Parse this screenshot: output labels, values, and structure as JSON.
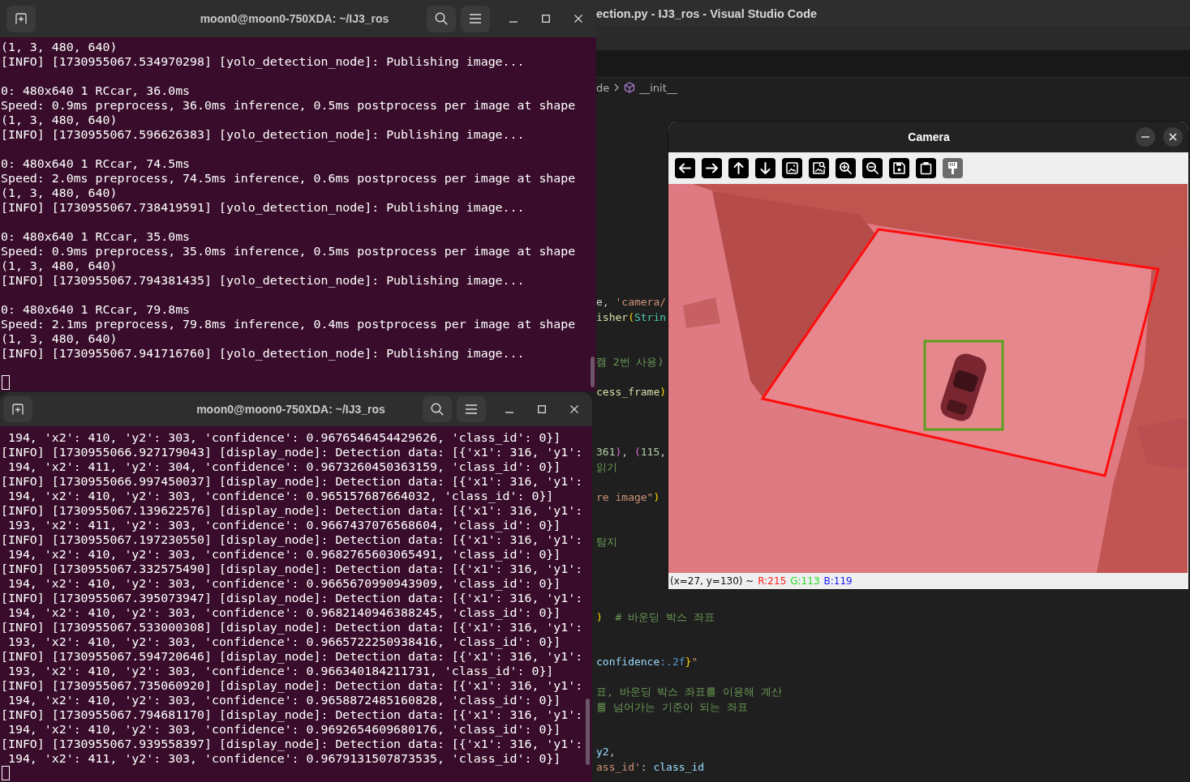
{
  "editor": {
    "title": "ection.py - IJ3_ros - Visual Studio Code",
    "breadcrumb": [
      {
        "text": "de",
        "kind": "plain"
      },
      {
        "text": "__init__",
        "kind": "method"
      }
    ],
    "lines": [
      {
        "tokens": [
          {
            "text": "e, ",
            "kind": "plain"
          },
          {
            "text": "'camera/",
            "kind": "string"
          }
        ]
      },
      {
        "tokens": [
          {
            "text": "isher",
            "kind": "function"
          },
          {
            "text": "(",
            "kind": "bracket"
          },
          {
            "text": "Strin",
            "kind": "class"
          }
        ]
      },
      {
        "tokens": [
          {
            "text": "캠 2번 사용)",
            "kind": "comment"
          }
        ]
      },
      {
        "tokens": [
          {
            "text": "cess_frame",
            "kind": "function"
          },
          {
            "text": ")",
            "kind": "bracket"
          }
        ]
      },
      {
        "tokens": [
          {
            "text": "361",
            "kind": "number"
          },
          {
            "text": ")",
            "kind": "bracket2"
          },
          {
            "text": ", ",
            "kind": "plain"
          },
          {
            "text": "(",
            "kind": "bracket2"
          },
          {
            "text": "115",
            "kind": "number"
          },
          {
            "text": ",",
            "kind": "plain"
          }
        ]
      },
      {
        "tokens": [
          {
            "text": "읽기",
            "kind": "comment"
          }
        ]
      },
      {
        "tokens": [
          {
            "text": "re image\"",
            "kind": "string"
          },
          {
            "text": ")",
            "kind": "bracket"
          }
        ]
      },
      {
        "tokens": [
          {
            "text": "탐지",
            "kind": "comment"
          }
        ]
      },
      {
        "tokens": [
          {
            "text": ")",
            "kind": "bracket"
          },
          {
            "text": "  # 바운딩 박스 좌표",
            "kind": "comment"
          }
        ]
      },
      {
        "tokens": [
          {
            "text": "confidence",
            "kind": "variable"
          },
          {
            "text": ":.2f",
            "kind": "format"
          },
          {
            "text": "}",
            "kind": "bracket"
          },
          {
            "text": "\"",
            "kind": "string"
          }
        ]
      },
      {
        "tokens": [
          {
            "text": "표, 바운딩 박스 좌표를 이용해 계산",
            "kind": "comment"
          }
        ]
      },
      {
        "tokens": [
          {
            "text": "를 넘어가는 기준이 되는 좌표",
            "kind": "comment"
          }
        ]
      },
      {
        "tokens": [
          {
            "text": "y2",
            "kind": "variable"
          },
          {
            "text": ",",
            "kind": "plain"
          }
        ]
      },
      {
        "tokens": [
          {
            "text": "ass_id'",
            "kind": "string"
          },
          {
            "text": ": ",
            "kind": "plain"
          },
          {
            "text": "class_id",
            "kind": "variable"
          }
        ]
      }
    ]
  },
  "camera": {
    "title": "Camera",
    "toolbar": [
      {
        "kind": "pan-left",
        "disabled": false
      },
      {
        "kind": "pan-right",
        "disabled": false
      },
      {
        "kind": "pan-up",
        "disabled": false
      },
      {
        "kind": "pan-down",
        "disabled": false
      },
      {
        "kind": "zoom-reset",
        "disabled": false
      },
      {
        "kind": "zoom-pixel",
        "disabled": false
      },
      {
        "kind": "zoom-in",
        "disabled": false
      },
      {
        "kind": "zoom-out",
        "disabled": false
      },
      {
        "kind": "save",
        "disabled": false
      },
      {
        "kind": "copy",
        "disabled": false
      },
      {
        "kind": "properties",
        "disabled": true
      }
    ],
    "status": {
      "position": "(x=27, y=130) ~",
      "r": "R:215",
      "g": "G:113",
      "b": "B:119"
    }
  },
  "terminals": [
    {
      "title": "moon0@moon0-750XDA: ~/IJ3_ros",
      "blocks": [
        [
          "(1, 3, 480, 640)",
          "[INFO] [1730955067.534970298] [yolo_detection_node]: Publishing image..."
        ],
        [
          "0: 480x640 1 RCcar, 36.0ms",
          "Speed: 0.9ms preprocess, 36.0ms inference, 0.5ms postprocess per image at shape",
          "(1, 3, 480, 640)",
          "[INFO] [1730955067.596626383] [yolo_detection_node]: Publishing image..."
        ],
        [
          "0: 480x640 1 RCcar, 74.5ms",
          "Speed: 2.0ms preprocess, 74.5ms inference, 0.6ms postprocess per image at shape",
          "(1, 3, 480, 640)",
          "[INFO] [1730955067.738419591] [yolo_detection_node]: Publishing image..."
        ],
        [
          "0: 480x640 1 RCcar, 35.0ms",
          "Speed: 0.9ms preprocess, 35.0ms inference, 0.5ms postprocess per image at shape",
          "(1, 3, 480, 640)",
          "[INFO] [1730955067.794381435] [yolo_detection_node]: Publishing image..."
        ],
        [
          "0: 480x640 1 RCcar, 79.8ms",
          "Speed: 2.1ms preprocess, 79.8ms inference, 0.4ms postprocess per image at shape",
          "(1, 3, 480, 640)",
          "[INFO] [1730955067.941716760] [yolo_detection_node]: Publishing image..."
        ]
      ]
    },
    {
      "title": "moon0@moon0-750XDA: ~/IJ3_ros",
      "lines": [
        " 194, 'x2': 410, 'y2': 303, 'confidence': 0.9676546454429626, 'class_id': 0}]",
        "[INFO] [1730955066.927179043] [display_node]: Detection data: [{'x1': 316, 'y1':",
        " 194, 'x2': 411, 'y2': 304, 'confidence': 0.9673260450363159, 'class_id': 0}]",
        "[INFO] [1730955066.997450037] [display_node]: Detection data: [{'x1': 316, 'y1':",
        " 194, 'x2': 410, 'y2': 303, 'confidence': 0.965157687664032, 'class_id': 0}]",
        "[INFO] [1730955067.139622576] [display_node]: Detection data: [{'x1': 316, 'y1':",
        " 193, 'x2': 411, 'y2': 303, 'confidence': 0.9667437076568604, 'class_id': 0}]",
        "[INFO] [1730955067.197230550] [display_node]: Detection data: [{'x1': 316, 'y1':",
        " 194, 'x2': 410, 'y2': 303, 'confidence': 0.9682765603065491, 'class_id': 0}]",
        "[INFO] [1730955067.332575490] [display_node]: Detection data: [{'x1': 316, 'y1':",
        " 194, 'x2': 410, 'y2': 303, 'confidence': 0.9665670990943909, 'class_id': 0}]",
        "[INFO] [1730955067.395073947] [display_node]: Detection data: [{'x1': 316, 'y1':",
        " 194, 'x2': 410, 'y2': 303, 'confidence': 0.9682140946388245, 'class_id': 0}]",
        "[INFO] [1730955067.533000308] [display_node]: Detection data: [{'x1': 316, 'y1':",
        " 193, 'x2': 410, 'y2': 303, 'confidence': 0.9665722250938416, 'class_id': 0}]",
        "[INFO] [1730955067.594720646] [display_node]: Detection data: [{'x1': 316, 'y1':",
        " 193, 'x2': 410, 'y2': 303, 'confidence': 0.966340184211731, 'class_id': 0}]",
        "[INFO] [1730955067.735060920] [display_node]: Detection data: [{'x1': 316, 'y1':",
        " 194, 'x2': 410, 'y2': 303, 'confidence': 0.9658872485160828, 'class_id': 0}]",
        "[INFO] [1730955067.794681170] [display_node]: Detection data: [{'x1': 316, 'y1':",
        " 194, 'x2': 410, 'y2': 303, 'confidence': 0.9692654609680176, 'class_id': 0}]",
        "[INFO] [1730955067.939558397] [display_node]: Detection data: [{'x1': 316, 'y1':",
        " 194, 'x2': 411, 'y2': 303, 'confidence': 0.9679131507873535, 'class_id': 0}]"
      ]
    }
  ]
}
